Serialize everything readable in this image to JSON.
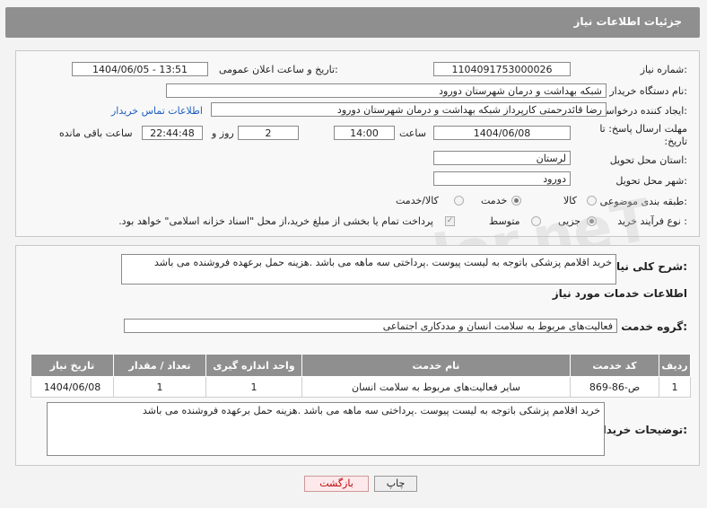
{
  "header": {
    "title": "جزئیات اطلاعات نیاز"
  },
  "fields": {
    "need_number_label": "شماره نیاز:",
    "need_number": "1104091753000026",
    "announce_label": "تاریخ و ساعت اعلان عمومی:",
    "announce_value": "1404/06/05 - 13:51",
    "buyer_org_label": "نام دستگاه خریدار:",
    "buyer_org": "شبکه بهداشت و درمان شهرستان دورود",
    "creator_label": "ایجاد کننده درخواست:",
    "creator": "رضا قائدرحمتی کارپرداز شبکه بهداشت و درمان شهرستان دورود",
    "contact_link": "اطلاعات تماس خریدار",
    "deadline_label": "مهلت ارسال پاسخ: تا تاریخ:",
    "deadline_date": "1404/06/08",
    "time_label": "ساعت",
    "deadline_time": "14:00",
    "days_count": "2",
    "days_label": "روز و",
    "remaining_time": "22:44:48",
    "remaining_label": "ساعت باقی مانده",
    "province_label": "استان محل تحویل:",
    "province": "لرستان",
    "city_label": "شهر محل تحویل:",
    "city": "دورود",
    "category_label": "طبقه بندی موضوعی:",
    "category_options": [
      "کالا",
      "خدمت",
      "کالا/خدمت"
    ],
    "process_label": "نوع فرآیند خرید :",
    "process_options": [
      "جزیی",
      "متوسط"
    ],
    "treasury_text": "پرداخت تمام یا بخشی از مبلغ خرید،از محل \"اسناد خزانه اسلامی\" خواهد بود."
  },
  "summary": {
    "label": "شرح کلی نیاز:",
    "text": "خرید اقلامم پزشکی باتوجه به لیست پیوست .پرداختی سه ماهه می باشد .هزینه حمل برعهده فروشنده می باشد"
  },
  "services": {
    "section_title": "اطلاعات خدمات مورد نیاز",
    "group_label": "گروه خدمت:",
    "group_value": "فعالیت‌های مربوط به سلامت انسان و مددکاری اجتماعی",
    "columns": [
      "ردیف",
      "کد خدمت",
      "نام خدمت",
      "واحد اندازه گیری",
      "تعداد / مقدار",
      "تاریخ نیاز"
    ],
    "rows": [
      [
        "1",
        "ص-86-869",
        "سایر فعالیت‌های مربوط به سلامت انسان",
        "1",
        "1",
        "1404/06/08"
      ]
    ]
  },
  "buyer_notes": {
    "label": "توضیحات خریدار:",
    "text": "خرید اقلامم پزشکی باتوجه به لیست پیوست .پرداختی سه ماهه می باشد .هزینه حمل برعهده فروشنده می باشد"
  },
  "buttons": {
    "print": "چاپ",
    "back": "بازگشت"
  },
  "watermark": "AriaTender.neT"
}
